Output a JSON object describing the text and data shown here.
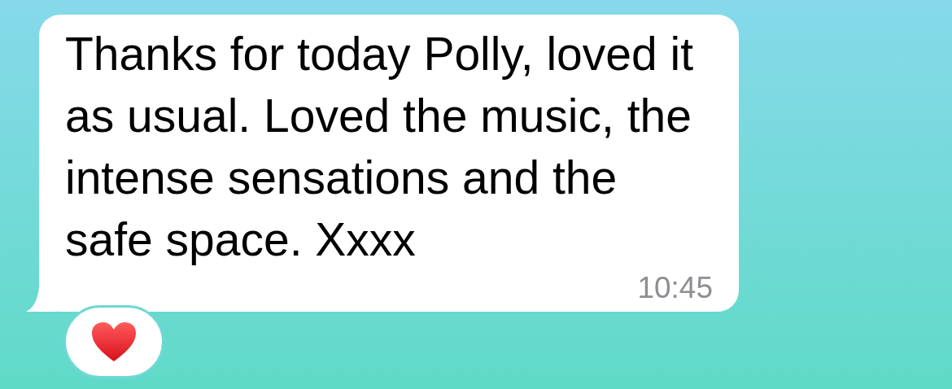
{
  "message": {
    "text": "Thanks for today Polly, loved it as usual. Loved the music, the intense sensations and the safe space. Xxxx",
    "time": "10:45"
  },
  "reaction": {
    "kind": "heart"
  }
}
